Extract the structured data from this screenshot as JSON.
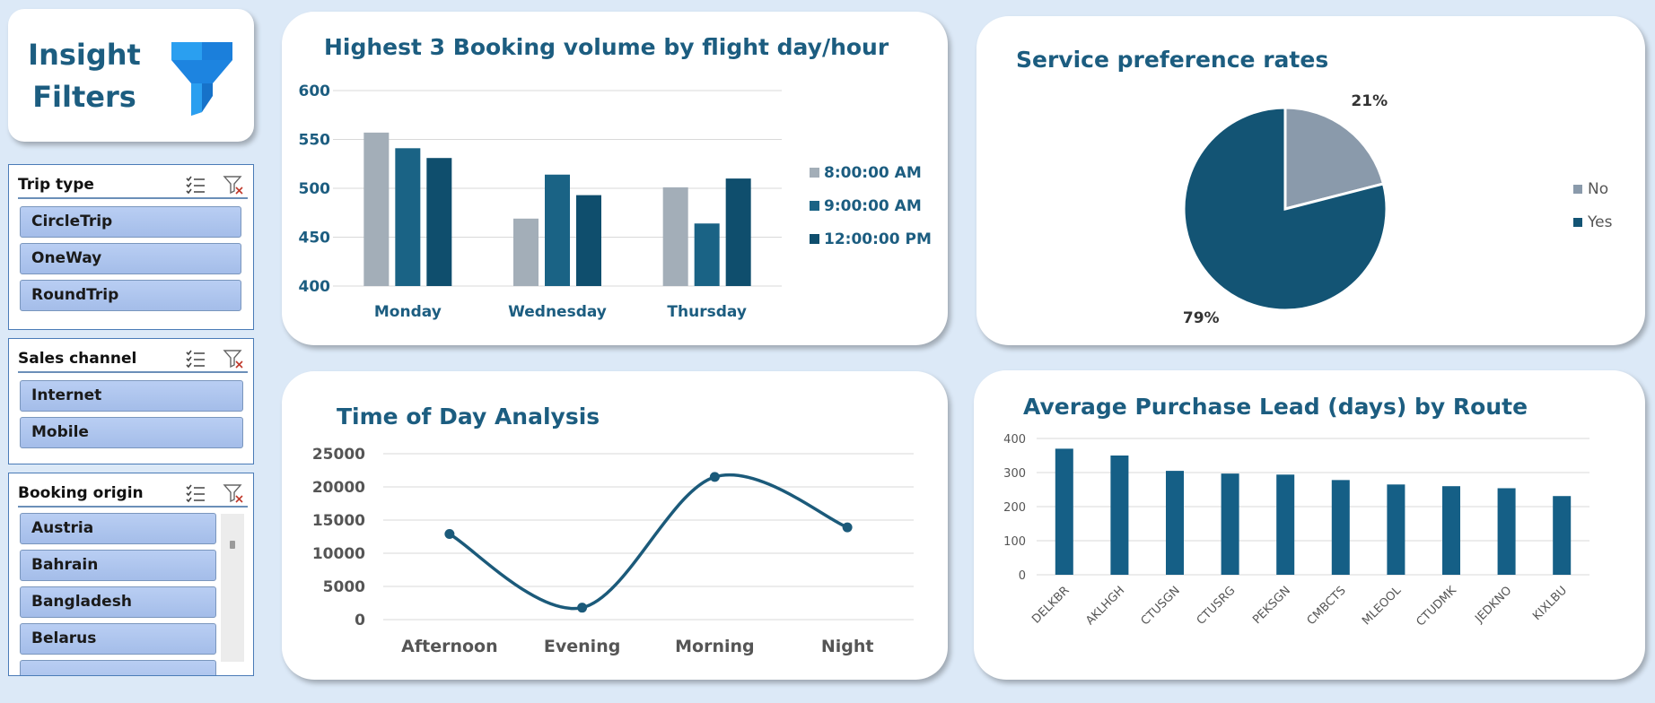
{
  "header": {
    "line1": "Insight",
    "line2": "Filters",
    "icon": "funnel-icon"
  },
  "slicers": [
    {
      "title": "Trip type",
      "items": [
        "CircleTrip",
        "OneWay",
        "RoundTrip"
      ]
    },
    {
      "title": "Sales channel",
      "items": [
        "Internet",
        "Mobile"
      ]
    },
    {
      "title": "Booking origin",
      "items": [
        "Austria",
        "Bahrain",
        "Bangladesh",
        "Belarus"
      ]
    }
  ],
  "colors": {
    "accent": "#1c5d80",
    "gray_series": "#a3aeb8",
    "mid_blue": "#1a6385",
    "dark_blue": "#0f4e6d",
    "pie_no": "#8a9aab",
    "pie_yes": "#135474",
    "line": "#1b5a7a",
    "bar": "#155f86",
    "background": "#dce9f7"
  },
  "chart_data": [
    {
      "type": "bar",
      "title": "Highest 3 Booking volume by flight day/hour",
      "categories": [
        "Monday",
        "Wednesday",
        "Thursday"
      ],
      "series": [
        {
          "name": "8:00:00 AM",
          "values": [
            557,
            469,
            501
          ]
        },
        {
          "name": "9:00:00 AM",
          "values": [
            541,
            514,
            464
          ]
        },
        {
          "name": "12:00:00 PM",
          "values": [
            531,
            493,
            510
          ]
        }
      ],
      "yticks": [
        "600",
        "550",
        "500",
        "450",
        "400"
      ],
      "ylim": [
        400,
        600
      ],
      "grid": true,
      "legend": "right"
    },
    {
      "type": "pie",
      "title": "Service preference rates",
      "labels": [
        "No",
        "Yes"
      ],
      "values": [
        21,
        79
      ],
      "value_labels": [
        "21%",
        "79%"
      ],
      "legend": "right"
    },
    {
      "type": "line",
      "title": "Time of Day Analysis",
      "categories": [
        "Afternoon",
        "Evening",
        "Morning",
        "Night"
      ],
      "values": [
        12900,
        1800,
        21500,
        13900
      ],
      "yticks": [
        "25000",
        "20000",
        "15000",
        "10000",
        "5000",
        "0"
      ],
      "ylim": [
        0,
        25000
      ],
      "grid": true,
      "smooth": true
    },
    {
      "type": "bar",
      "title": "Average Purchase Lead (days) by Route",
      "categories": [
        "DELKBR",
        "AKLHGH",
        "CTUSGN",
        "CTUSRG",
        "PEKSGN",
        "CMBCTS",
        "MLEOOL",
        "CTUDMK",
        "JEDKNO",
        "KIXLBU"
      ],
      "values": [
        370,
        350,
        305,
        297,
        294,
        278,
        265,
        260,
        254,
        231
      ],
      "yticks": [
        "400",
        "300",
        "200",
        "100",
        "0"
      ],
      "ylim": [
        0,
        400
      ],
      "grid": true
    }
  ]
}
